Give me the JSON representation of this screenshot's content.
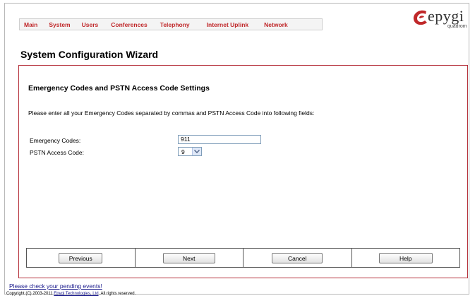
{
  "nav": {
    "items": [
      "Main",
      "System",
      "Users",
      "Conferences",
      "Telephony",
      "Internet Uplink",
      "Network"
    ]
  },
  "logo": {
    "text": "epygi",
    "sub": "quadrom"
  },
  "page": {
    "title": "System Configuration Wizard"
  },
  "panel": {
    "title": "Emergency Codes and PSTN Access Code Settings",
    "instructions": "Please enter all your Emergency Codes separated by commas and PSTN Access Code into following fields:",
    "fields": {
      "emergency_label": "Emergency Codes:",
      "emergency_value": "911",
      "pstn_label": "PSTN Access Code:",
      "pstn_value": "9"
    },
    "buttons": {
      "previous": "Previous",
      "next": "Next",
      "cancel": "Cancel",
      "help": "Help"
    }
  },
  "footer": {
    "pending": "Please check your pending events!",
    "copyright_prefix": "Copyright (C) 2003-2011 ",
    "copyright_link": "Epygi Technologies, Ltd",
    "copyright_suffix": ". All rights reserved."
  },
  "colors": {
    "nav_text": "#c0282a",
    "panel_border": "#b5303a",
    "link": "#1a1a8c"
  }
}
